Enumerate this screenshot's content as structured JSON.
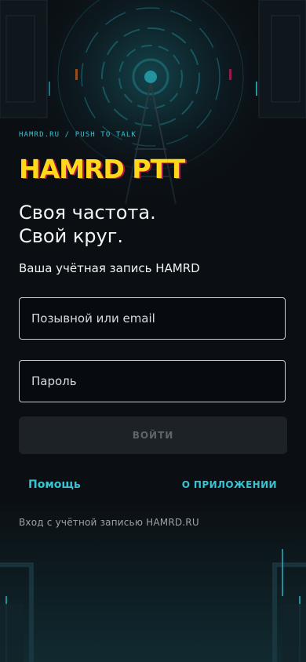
{
  "header": {
    "eyebrow": "HAMRD.RU / PUSH TO TALK",
    "brand": "HAMRD PTT",
    "tagline_line1": "Своя частота.",
    "tagline_line2": "Свой круг.",
    "subtitle": "Ваша учётная запись HAMRD"
  },
  "form": {
    "callsign_placeholder": "Позывной или email",
    "password_placeholder": "Пароль",
    "login_label": "ВОЙТИ"
  },
  "links": {
    "help": "Помощь",
    "about": "О ПРИЛОЖЕНИИ"
  },
  "footer": {
    "note": "Вход с учётной записью HAMRD.RU"
  },
  "colors": {
    "accent_yellow": "#ffd81a",
    "accent_cyan": "#35c4d3",
    "brand_shadow": "#b7124e",
    "background": "#0b0f13"
  },
  "icons": [
    "radar-tower-illustration"
  ]
}
